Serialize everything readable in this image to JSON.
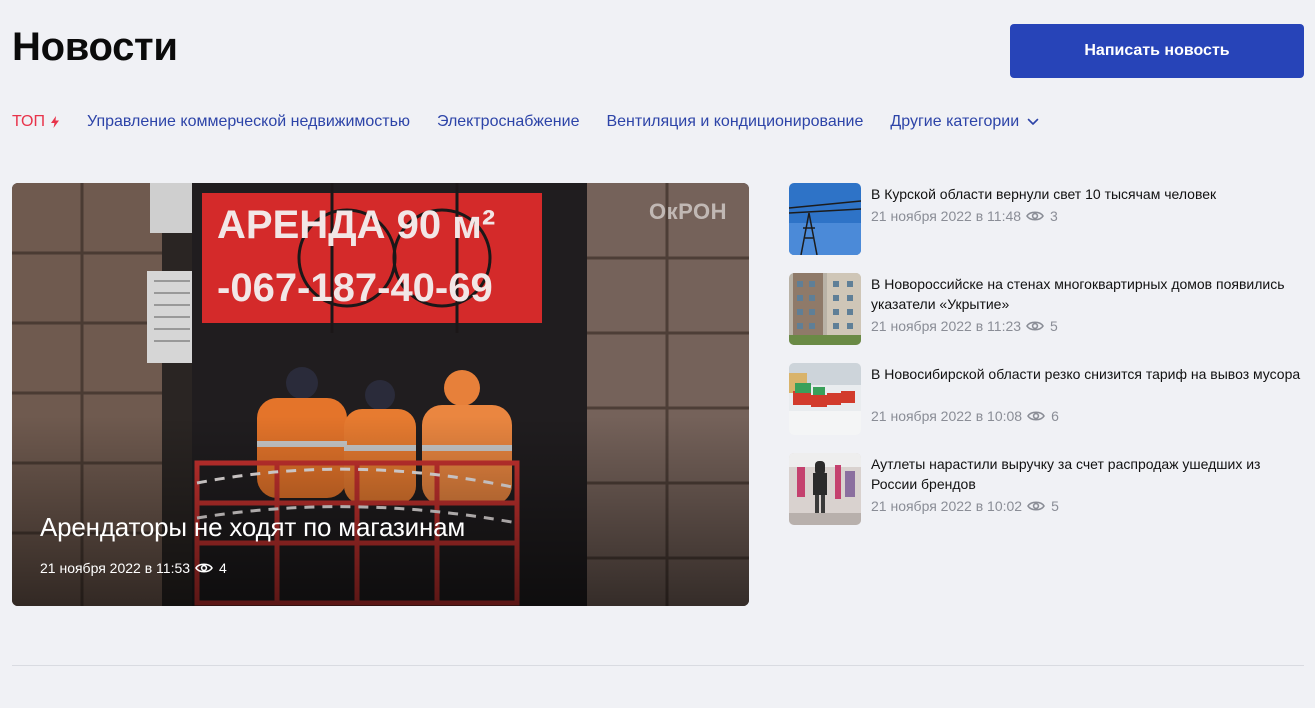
{
  "header": {
    "title": "Новости",
    "write_button": "Написать новость"
  },
  "categories": {
    "top": "ТОП",
    "items": [
      "Управление коммерческой недвижимостью",
      "Электроснабжение",
      "Вентиляция и кондиционирование"
    ],
    "more": "Другие категории"
  },
  "featured": {
    "title": "Арендаторы не ходят по магазинам",
    "date": "21 ноября 2022 в 11:53",
    "views": "4",
    "watermark": "ОкРОН"
  },
  "news": [
    {
      "title": "В Курской области вернули свет 10 тысячам человек",
      "date": "21 ноября 2022 в 11:48",
      "views": "3"
    },
    {
      "title": "В Новороссийске на стенах многоквартирных домов появились указатели «Укрытие»",
      "date": "21 ноября 2022 в 11:23",
      "views": "5"
    },
    {
      "title": "В Новосибирской области резко снизится тариф на вывоз мусора",
      "date": "21 ноября 2022 в 10:08",
      "views": "6"
    },
    {
      "title": "Аутлеты нарастили выручку за счет распродаж ушедших из России брендов",
      "date": "21 ноября 2022 в 10:02",
      "views": "5"
    }
  ],
  "colors": {
    "accent": "#2744b8",
    "link": "#2d44a8",
    "top": "#e8334a",
    "muted": "#8a8d96",
    "background": "#f0f1f5"
  }
}
